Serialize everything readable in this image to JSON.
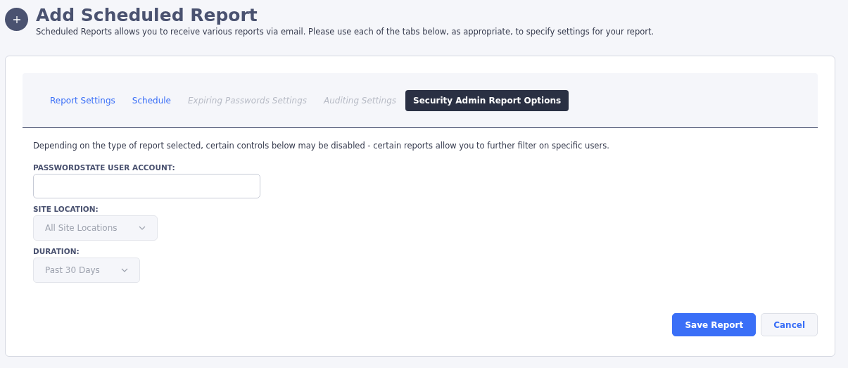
{
  "header": {
    "title": "Add Scheduled Report",
    "description": "Scheduled Reports allows you to receive various reports via email. Please use each of the tabs below, as appropriate, to specify settings for your report."
  },
  "tabs": [
    {
      "label": "Report Settings",
      "selected": false,
      "disabled": false
    },
    {
      "label": "Schedule",
      "selected": false,
      "disabled": false
    },
    {
      "label": "Expiring Passwords Settings",
      "selected": false,
      "disabled": true
    },
    {
      "label": "Auditing Settings",
      "selected": false,
      "disabled": true
    },
    {
      "label": "Security Admin Report Options",
      "selected": true,
      "disabled": false
    }
  ],
  "note": "Depending on the type of report selected, certain controls below may be disabled - certain reports allow you to further filter on specific users.",
  "fields": [
    {
      "kind": "text",
      "label": "PASSWORDSTATE USER ACCOUNT:",
      "disabled": false
    },
    {
      "kind": "select",
      "label": "SITE LOCATION:",
      "value": "All Site Locations",
      "disabled": true
    },
    {
      "kind": "select",
      "label": "DURATION:",
      "value": "Past 30 Days",
      "disabled": true
    }
  ],
  "buttons": [
    {
      "kind": "primary",
      "label": "Save Report"
    },
    {
      "kind": "secondary",
      "label": "Cancel"
    }
  ]
}
